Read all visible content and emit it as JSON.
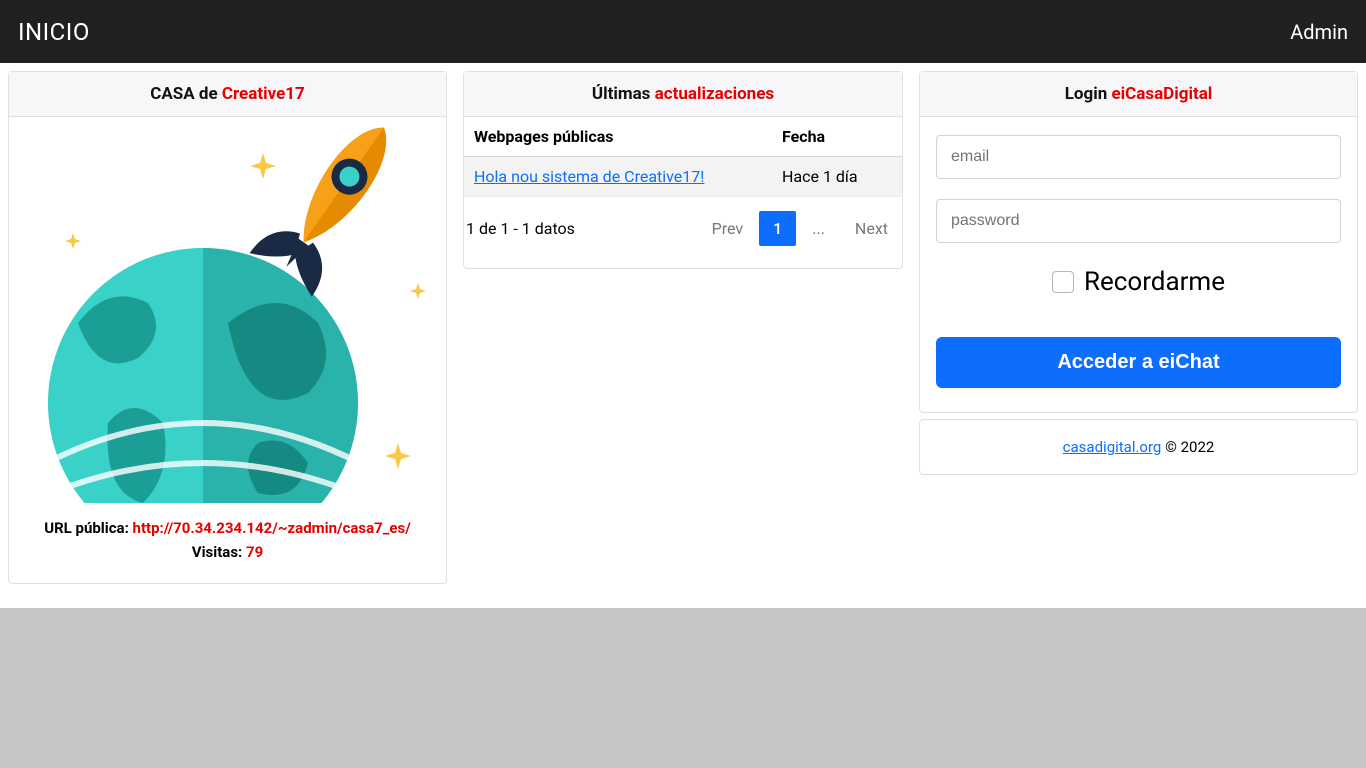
{
  "navbar": {
    "brand": "INICIO",
    "admin": "Admin"
  },
  "left": {
    "title_prefix": "CASA de ",
    "title_accent": "Creative17",
    "url_label": "URL pública: ",
    "url_value": "http://70.34.234.142/~zadmin/casa7_es/",
    "visits_label": "Visitas: ",
    "visits_value": "79"
  },
  "mid": {
    "title_prefix": "Últimas ",
    "title_accent": "actualizaciones",
    "col_webpages": "Webpages públicas",
    "col_date": "Fecha",
    "rows": [
      {
        "title": "Hola nou sistema de Creative17!",
        "date": "Hace 1 día"
      }
    ],
    "summary": "1 de 1 - 1 datos",
    "prev": "Prev",
    "page1": "1",
    "ellipsis": "...",
    "next": "Next"
  },
  "right": {
    "title_prefix": "Login ",
    "title_accent": "eiCasaDigital",
    "email_placeholder": "email",
    "password_placeholder": "password",
    "remember_label": "Recordarme",
    "submit": "Acceder a eiChat",
    "footer_link": "casadigital.org",
    "footer_rest": " © 2022"
  }
}
